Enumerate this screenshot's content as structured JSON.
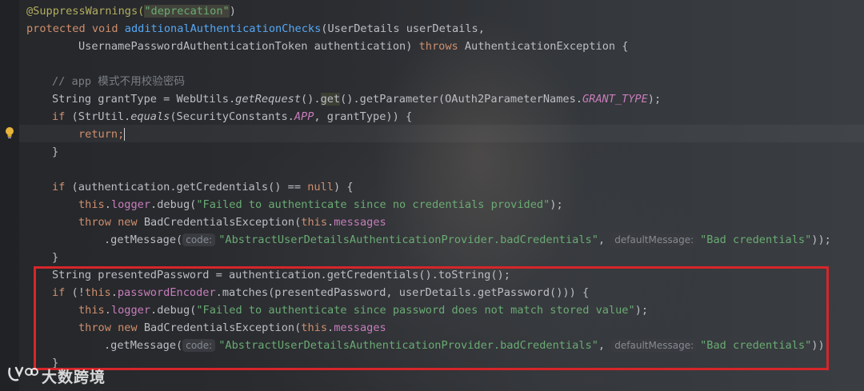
{
  "code": {
    "l1_annotation": "@SuppressWarnings(",
    "l1_string": "\"deprecation\"",
    "l1_close": ")",
    "l2_protected": "protected ",
    "l2_void": "void ",
    "l2_method": "additionalAuthenticationChecks",
    "l2_rest": "(UserDetails userDetails,",
    "l3_params": "UsernamePasswordAuthenticationToken authentication) ",
    "l3_throws": "throws",
    "l3_rest": " AuthenticationException {",
    "l5_comment": "// app 模式不用校验密码",
    "l6_a": "String grantType = WebUtils.",
    "l6_getRequest": "getRequest",
    "l6_b": "().",
    "l6_get": "get",
    "l6_c": "().getParameter(OAuth2ParameterNames.",
    "l6_grant": "GRANT_TYPE",
    "l6_d": ");",
    "l7_if": "if",
    "l7_a": " (StrUtil.",
    "l7_equals": "equals",
    "l7_b": "(SecurityConstants.",
    "l7_app": "APP",
    "l7_c": ", grantType)) {",
    "l8_return": "return",
    "l8_semi": ";",
    "l9_brace": "}",
    "l11_if": "if",
    "l11_a": " (authentication.getCredentials() == ",
    "l11_null": "null",
    "l11_b": ") {",
    "debug_this": "this",
    "debug_dot": ".",
    "debug_logger": "logger",
    "debug_call": ".debug(",
    "l12_msg": "\"Failed to authenticate since no credentials provided\"",
    "debug_end": ");",
    "throw_kw": "throw ",
    "new_kw": "new ",
    "throw_class": "BadCredentialsException(",
    "this_kw": "this",
    "messages_field": "messages",
    "getmsg_call": ".getMessage(",
    "hint_code": "code:",
    "badcred_key": "\"AbstractUserDetailsAuthenticationProvider.badCredentials\"",
    "comma": ", ",
    "hint_default": "defaultMessage:",
    "badcred_default": "\"Bad credentials\"",
    "getmsg_end": "));",
    "l15_brace": "}",
    "l16": "String presentedPassword = authentication.getCredentials().toString();",
    "l17_if": "if",
    "l17_a": " (!",
    "l17_this": "this",
    "l17_dot": ".",
    "l17_encoder": "passwordEncoder",
    "l17_b": ".matches(presentedPassword, userDetails.getPassword())) {",
    "l18_msg": "\"Failed to authenticate since password does not match stored value\"",
    "l21_brace": "}"
  },
  "watermark": {
    "text": "大数跨境"
  },
  "icons": {
    "gutter": "lightbulb-icon",
    "watermark": "logo-icon"
  },
  "colors": {
    "keyword": "#cf8e6d",
    "method": "#56a8f5",
    "string": "#6aab73",
    "annotation": "#b3ae60",
    "field": "#c77dbb",
    "comment": "#7a7e85",
    "highlight_box": "#d6262a"
  }
}
